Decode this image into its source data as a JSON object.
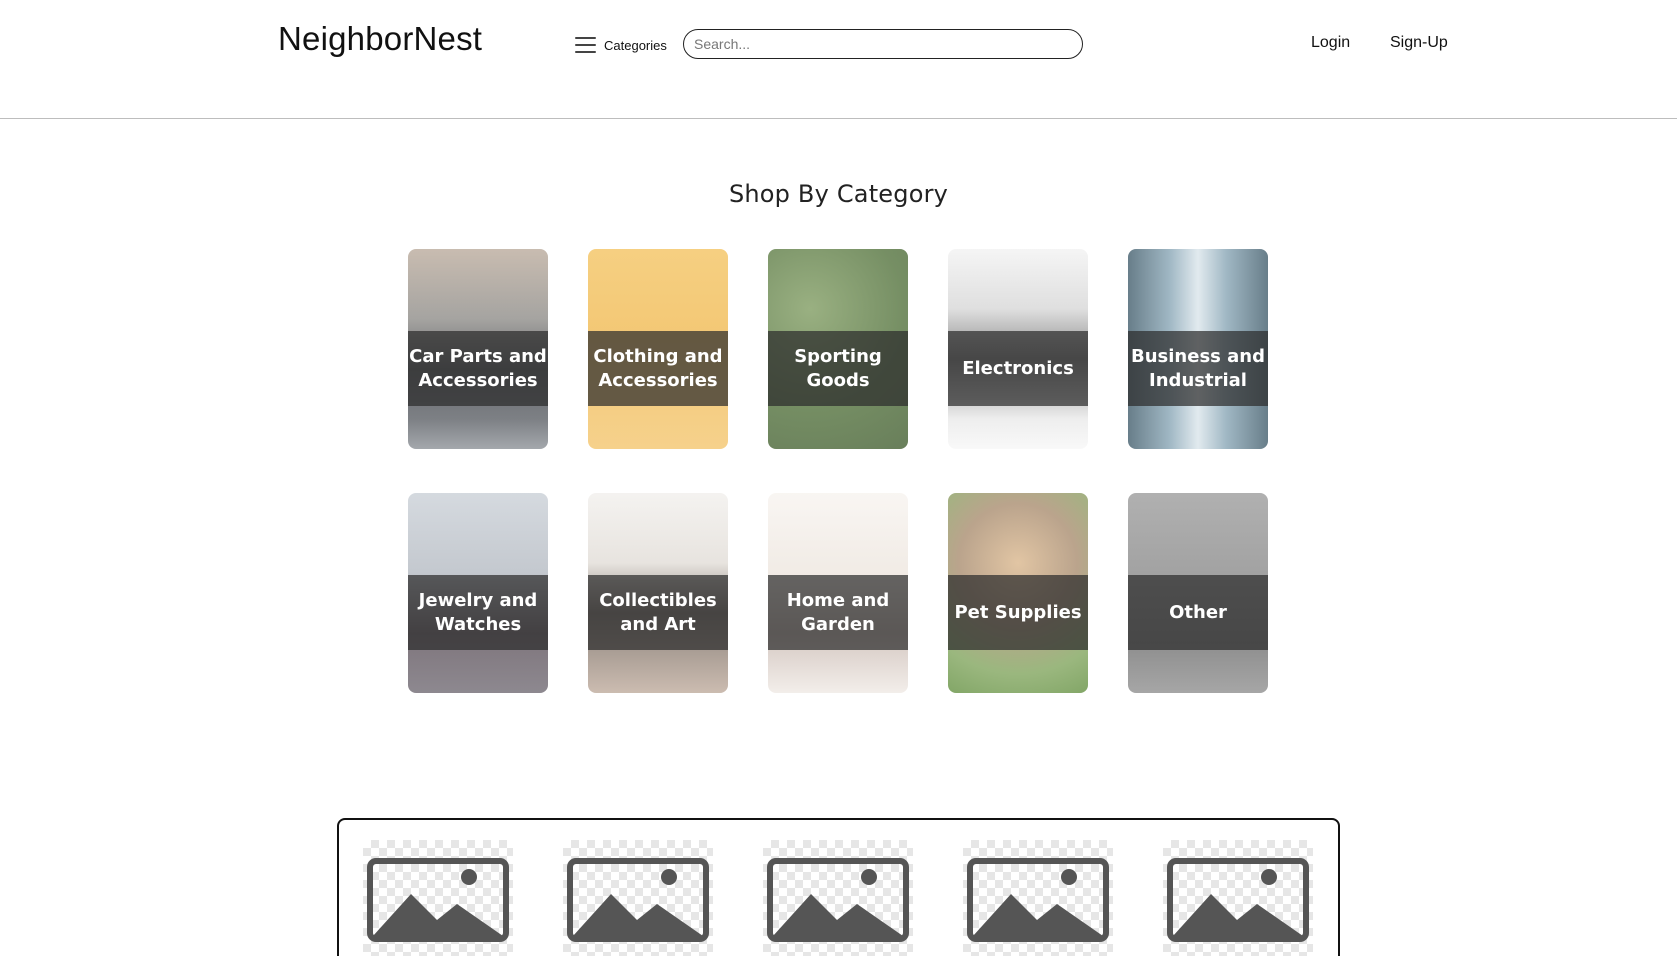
{
  "header": {
    "logo": "NeighborNest",
    "categories_label": "Categories",
    "search_placeholder": "Search...",
    "login_label": "Login",
    "signup_label": "Sign-Up"
  },
  "main": {
    "section_title": "Shop By Category",
    "categories": [
      {
        "label": "Car Parts and Accessories"
      },
      {
        "label": "Clothing and Accessories"
      },
      {
        "label": "Sporting Goods"
      },
      {
        "label": "Electronics"
      },
      {
        "label": "Business and Industrial"
      },
      {
        "label": "Jewelry and Watches"
      },
      {
        "label": "Collectibles and Art"
      },
      {
        "label": "Home and Garden"
      },
      {
        "label": "Pet Supplies"
      },
      {
        "label": "Other"
      }
    ]
  },
  "products": {
    "placeholder_icon": "image-placeholder-icon"
  }
}
